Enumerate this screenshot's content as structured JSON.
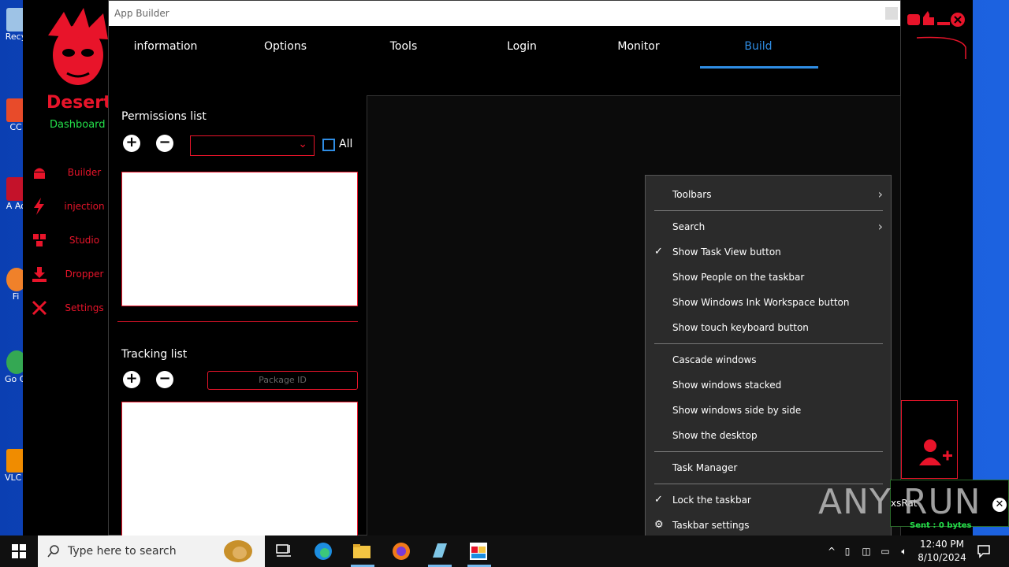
{
  "desktop": {
    "icons": [
      {
        "label": "Recy",
        "color": "#9ec3e6"
      },
      {
        "label": "CC",
        "color": "#e84b2a"
      },
      {
        "label": "A Ac",
        "color": "#c4122a"
      },
      {
        "label": "Fi",
        "color": "#f0812a"
      },
      {
        "label": "Go Ch",
        "color": "#34a853"
      },
      {
        "label": "VLC pl",
        "color": "#f08c00"
      }
    ]
  },
  "dashboard": {
    "title": "Desert",
    "subtitle": "Dashboard",
    "nav": [
      {
        "label": "Builder",
        "icon": "android-icon"
      },
      {
        "label": "injection",
        "icon": "lightning-icon"
      },
      {
        "label": "Studio",
        "icon": "cubes-icon"
      },
      {
        "label": "Dropper",
        "icon": "download-icon"
      },
      {
        "label": "Settings",
        "icon": "tools-icon"
      }
    ]
  },
  "window": {
    "title": "App Builder",
    "tabs": [
      {
        "label": "information"
      },
      {
        "label": "Options"
      },
      {
        "label": "Tools"
      },
      {
        "label": "Login"
      },
      {
        "label": "Monitor"
      },
      {
        "label": "Build",
        "active": true
      }
    ],
    "permissions": {
      "label": "Permissions list",
      "select_value": "",
      "all_label": "All"
    },
    "tracking": {
      "label": "Tracking list",
      "package_placeholder": "Package ID"
    }
  },
  "context_menu": {
    "items": [
      {
        "label": "Toolbars",
        "submenu": true
      },
      {
        "label": "Search",
        "submenu": true
      },
      {
        "label": "Show Task View button",
        "checked": true
      },
      {
        "label": "Show People on the taskbar"
      },
      {
        "label": "Show Windows Ink Workspace button"
      },
      {
        "label": "Show touch keyboard button"
      },
      {
        "label": "Cascade windows"
      },
      {
        "label": "Show windows stacked"
      },
      {
        "label": "Show windows side by side"
      },
      {
        "label": "Show the desktop"
      },
      {
        "label": "Task Manager"
      },
      {
        "label": "Lock the taskbar",
        "checked": true
      },
      {
        "label": "Taskbar settings",
        "icon": "gear-icon"
      }
    ]
  },
  "notification": {
    "text": "xsRat",
    "bytes": "Sent : 0 bytes"
  },
  "watermark": "ANY RUN",
  "taskbar": {
    "search_placeholder": "Type here to search",
    "time": "12:40 PM",
    "date": "8/10/2024"
  },
  "colors": {
    "accent_red": "#e8142a",
    "accent_blue": "#2f8de4",
    "accent_green": "#23e04a"
  }
}
